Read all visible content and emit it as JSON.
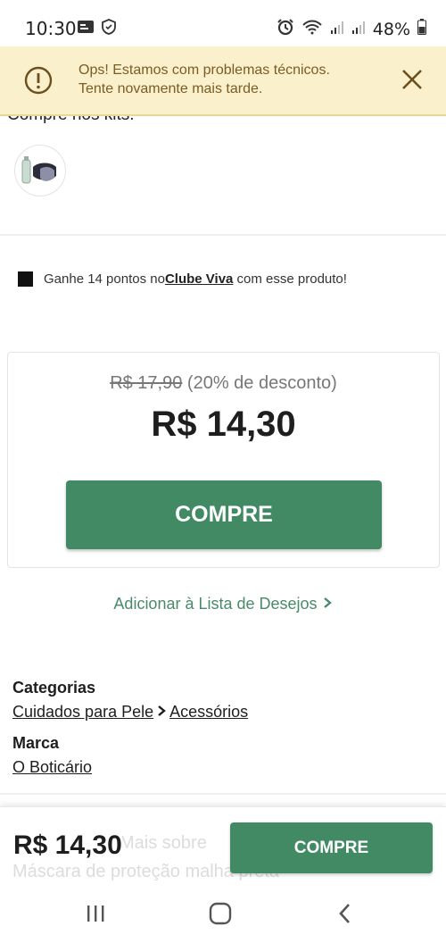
{
  "status_bar": {
    "time": "10:30",
    "battery": "48%",
    "left_icons": [
      "card-icon",
      "shield-icon"
    ],
    "right_icons": [
      "alarm-icon",
      "wifi-icon",
      "signal-icon",
      "signal-icon",
      "battery-icon"
    ]
  },
  "banner": {
    "line1": "Ops! Estamos com problemas técnicos.",
    "line2": "Tente novamente mais tarde.",
    "icon": "warning-icon",
    "close_icon": "close-icon",
    "bg_color": "#fbf0cc"
  },
  "kits": {
    "title": "Compre nos kits:"
  },
  "clube": {
    "prefix": "Ganhe 14 pontos no ",
    "link": "Clube Viva",
    "suffix": " com esse produto!"
  },
  "price": {
    "old": "R$ 17,90",
    "discount": "(20% de desconto)",
    "current": "R$ 14,30",
    "buy_label": "COMPRE"
  },
  "wishlist": {
    "label": "Adicionar à Lista de Desejos",
    "icon": "chevron-right-icon"
  },
  "details": {
    "categories_label": "Categorias",
    "category_1": "Cuidados para Pele",
    "category_2": "Acessórios",
    "brand_label": "Marca",
    "brand": "O Boticário"
  },
  "bottom_bar": {
    "price": "R$ 14,30",
    "buy_label": "COMPRE",
    "ghost_line1": "Mais sobre",
    "ghost_line2": "Máscara de proteção malha preta"
  },
  "colors": {
    "accent": "#418a63",
    "link_green": "#4a8a6a",
    "banner_text": "#7a5c25"
  }
}
